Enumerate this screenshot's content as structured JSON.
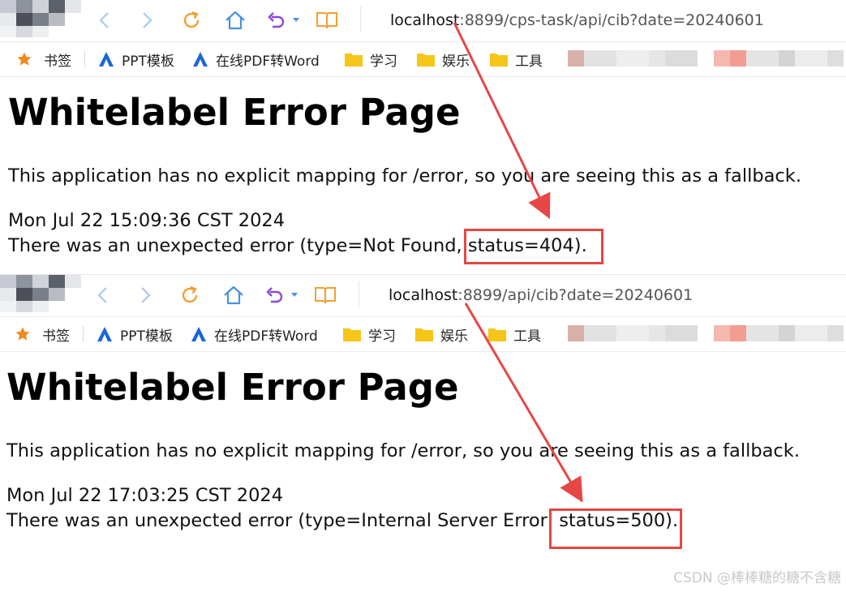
{
  "screens": [
    {
      "url": {
        "host": "localhost",
        "rest": ":8899/cps-task/api/cib?date=20240601"
      },
      "page": {
        "title": "Whitelabel Error Page",
        "message": "This application has no explicit mapping for /error, so you are seeing this as a fallback.",
        "timestamp": "Mon Jul 22 15:09:36 CST 2024",
        "error_prefix": "There was an unexpected error (type=Not Found",
        "error_status": ", status=404)",
        "error_suffix": "."
      }
    },
    {
      "url": {
        "host": "localhost",
        "rest": ":8899/api/cib?date=20240601"
      },
      "page": {
        "title": "Whitelabel Error Page",
        "message": "This application has no explicit mapping for /error, so you are seeing this as a fallback.",
        "timestamp": "Mon Jul 22 17:03:25 CST 2024",
        "error_prefix": "There was an unexpected error (type=Internal Server Error",
        "error_status": ", status=500)",
        "error_suffix": "."
      }
    }
  ],
  "bookmarks": {
    "star_label": "书签",
    "items": [
      {
        "label": "PPT模板",
        "icon": "a-logo-icon"
      },
      {
        "label": "在线PDF转Word",
        "icon": "a-logo-icon"
      },
      {
        "label": "学习",
        "icon": "folder-icon"
      },
      {
        "label": "娱乐",
        "icon": "folder-icon"
      },
      {
        "label": "工具",
        "icon": "folder-icon"
      }
    ]
  },
  "watermark": "CSDN @棒棒糖的糖不含糖",
  "colors": {
    "annotation_red": "#e74646",
    "nav_blue": "#4a90e2",
    "refresh_orange": "#f0a030",
    "undo_purple": "#8a4ad8",
    "folder_yellow": "#f5c518",
    "star_orange": "#f08a1a"
  }
}
